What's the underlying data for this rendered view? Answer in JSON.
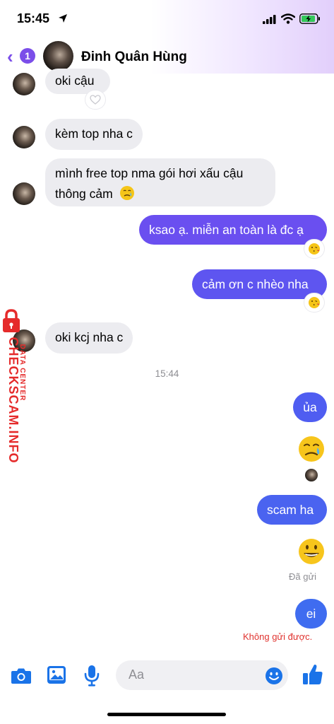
{
  "status_bar": {
    "time": "15:45"
  },
  "header": {
    "back_badge": "1",
    "contact_name": "Đinh Quân Hùng"
  },
  "messages": {
    "m1": "oki cậu",
    "m2": "kèm top nha c",
    "m3_line1": "mình free top nma gói hơi xấu cậu",
    "m3_line2": "thông cảm",
    "m4": "ksao ạ. miễn an toàn là đc ạ",
    "m5": "cảm ơn c nhèo nha",
    "m6": "oki kcj nha c",
    "timestamp": "15:44",
    "m7": "ủa",
    "m9": "scam ha",
    "status_sent": "Đã gửi",
    "m11": "ei",
    "status_failed": "Không gửi được."
  },
  "composer": {
    "placeholder": "Aa"
  },
  "watermark": {
    "text": "CHECKSCAM.INFO",
    "sub": "DATA CENTER"
  },
  "colors": {
    "accent": "#7b4ee9",
    "outgoing_purple": "#6a4ff0",
    "outgoing_blue": "#4a63f0",
    "incoming": "#ececf0",
    "toolbar_blue": "#1a73e8",
    "error_red": "#e0332f",
    "watermark_red": "#e52b2b"
  },
  "icons": [
    "location-arrow-icon",
    "signal-icon",
    "wifi-icon",
    "battery-icon",
    "back-chevron-icon",
    "camera-icon",
    "image-icon",
    "microphone-icon",
    "emoji-icon",
    "thumbs-up-icon",
    "heart-reaction-icon",
    "kiss-reaction-icon"
  ]
}
